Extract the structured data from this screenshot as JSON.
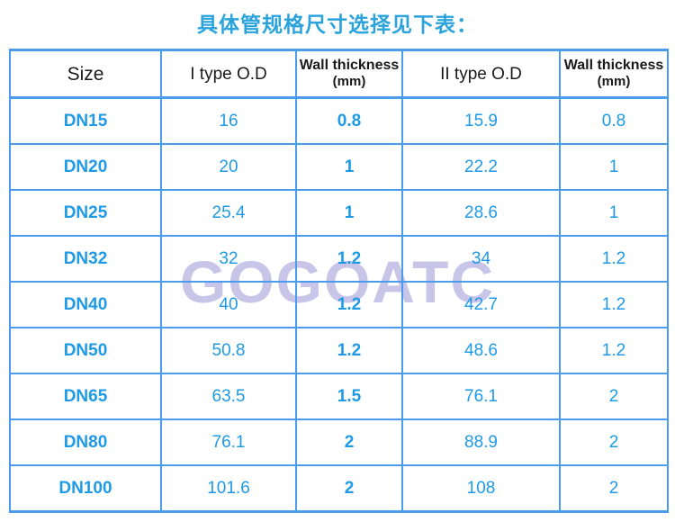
{
  "title": "具体管规格尺寸选择见下表：",
  "watermark": "GOGOATC",
  "colors": {
    "title_blue": "#2aa3dd",
    "data_blue": "#1e9ae6",
    "border_blue": "#4c9ced",
    "header_text": "#1a1a1a",
    "watermark": "#c9c5e9",
    "background": "#ffffff"
  },
  "table": {
    "headers": [
      {
        "label": "Size",
        "sub": ""
      },
      {
        "label": "I type O.D",
        "sub": ""
      },
      {
        "label": "Wall thickness",
        "sub": "(mm)"
      },
      {
        "label": "II  type O.D",
        "sub": ""
      },
      {
        "label": "Wall thickness",
        "sub": "(mm)"
      }
    ],
    "rows": [
      {
        "size": "DN15",
        "od1": "16",
        "wt1": "0.8",
        "od2": "15.9",
        "wt2": "0.8"
      },
      {
        "size": "DN20",
        "od1": "20",
        "wt1": "1",
        "od2": "22.2",
        "wt2": "1"
      },
      {
        "size": "DN25",
        "od1": "25.4",
        "wt1": "1",
        "od2": "28.6",
        "wt2": "1"
      },
      {
        "size": "DN32",
        "od1": "32",
        "wt1": "1.2",
        "od2": "34",
        "wt2": "1.2"
      },
      {
        "size": "DN40",
        "od1": "40",
        "wt1": "1.2",
        "od2": "42.7",
        "wt2": "1.2"
      },
      {
        "size": "DN50",
        "od1": "50.8",
        "wt1": "1.2",
        "od2": "48.6",
        "wt2": "1.2"
      },
      {
        "size": "DN65",
        "od1": "63.5",
        "wt1": "1.5",
        "od2": "76.1",
        "wt2": "2"
      },
      {
        "size": "DN80",
        "od1": "76.1",
        "wt1": "2",
        "od2": "88.9",
        "wt2": "2"
      },
      {
        "size": "DN100",
        "od1": "101.6",
        "wt1": "2",
        "od2": "108",
        "wt2": "2"
      }
    ]
  }
}
